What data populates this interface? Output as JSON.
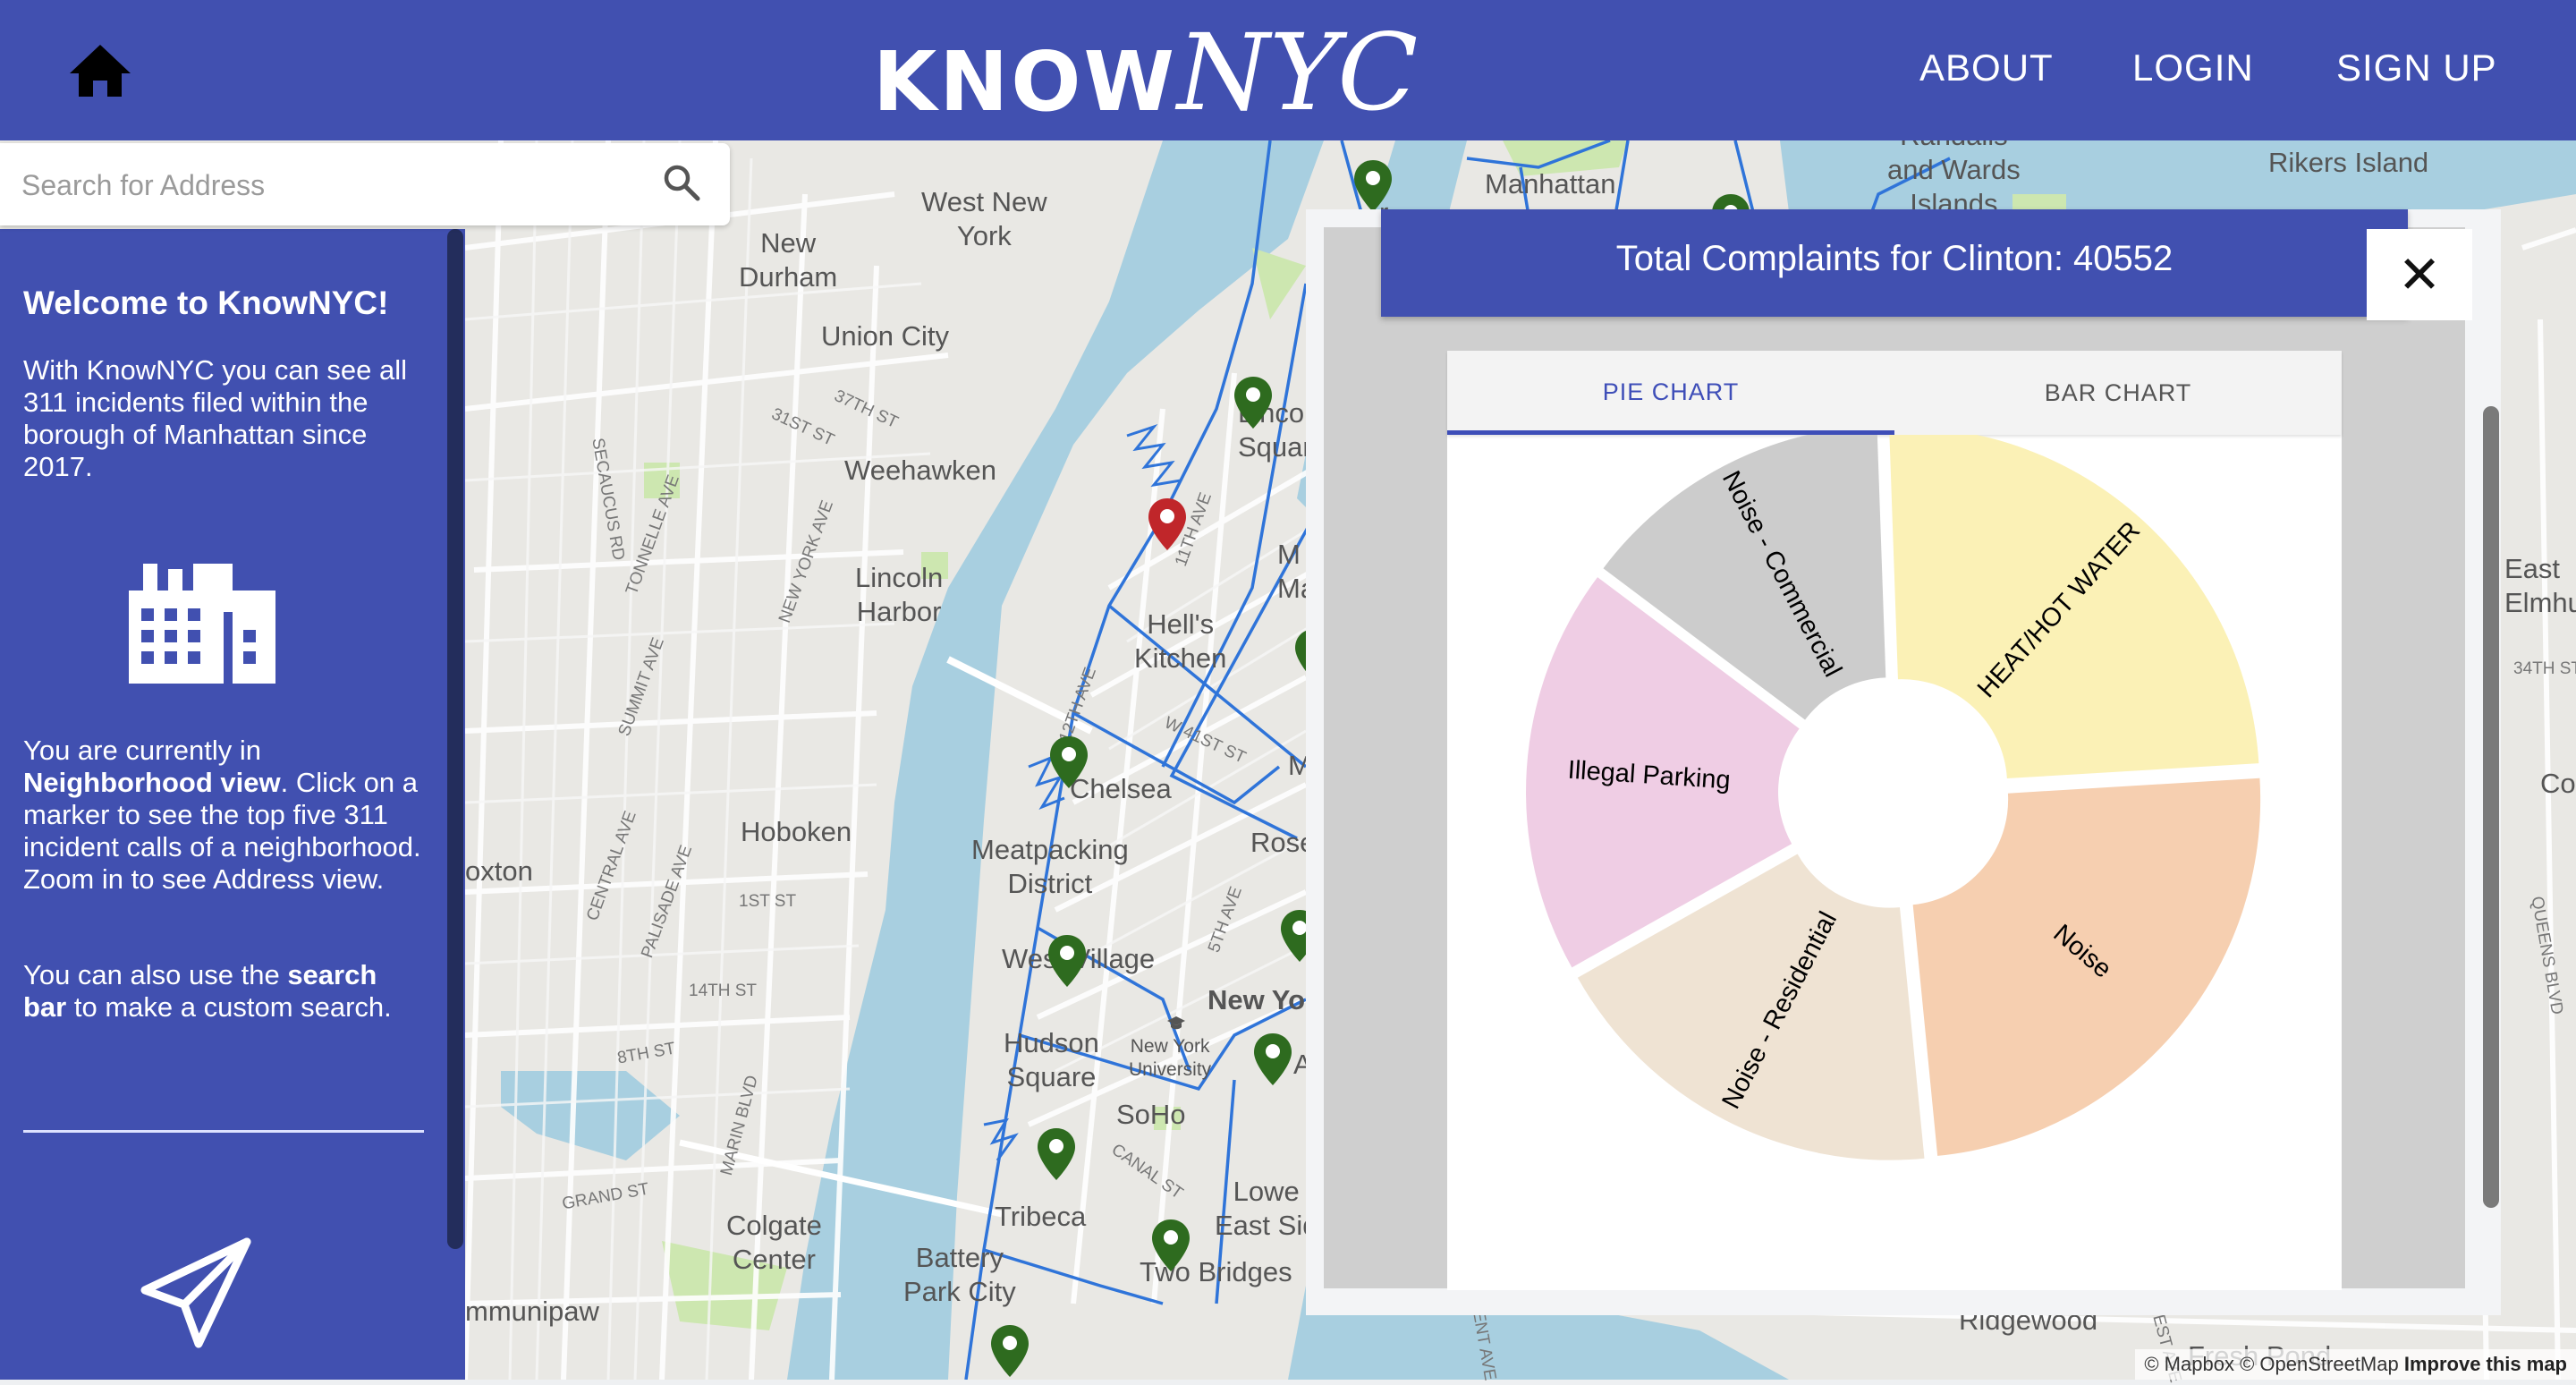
{
  "header": {
    "brand_know": "KNOW",
    "brand_nyc": "NYC",
    "nav": {
      "about": "ABOUT",
      "login": "LOGIN",
      "signup": "SIGN UP"
    }
  },
  "search": {
    "placeholder": "Search for Address"
  },
  "sidebar": {
    "title": "Welcome to KnowNYC!",
    "intro": "With KnowNYC you can see all 311 incidents filed within the borough of Manhattan since 2017.",
    "mode_prefix": "You are currently in ",
    "mode_bold": "Neighborhood view",
    "mode_suffix": ". Click on a marker to see the top five 311 incident calls of a neighborhood. Zoom in to see Address view.",
    "hint_prefix": "You can also use the ",
    "hint_bold": "search bar",
    "hint_suffix": " to make a custom search."
  },
  "map": {
    "labels": {
      "west_new_york": "West New\nYork",
      "new_durham": "New\nDurham",
      "union_city": "Union City",
      "weehawken": "Weehawken",
      "lincoln_harbor": "Lincoln\nHarbor",
      "hoboken": "Hoboken",
      "hells_kitchen": "Hell's\nKitchen",
      "chelsea": "Chelsea",
      "meatpacking": "Meatpacking\nDistrict",
      "west_village": "West Village",
      "new_york": "New Yo",
      "nyu": "New York\nUniversity",
      "hudson_square": "Hudson\nSquare",
      "soho": "SoHo",
      "tribeca": "Tribeca",
      "lower_east_side": "Lowe\nEast Sid",
      "two_bridges": "Two Bridges",
      "battery_park": "Battery\nPark City",
      "colgate_center": "Colgate\nCenter",
      "communipaw": "mmunipaw",
      "oxton": "oxton",
      "manhattan": "Manhattan",
      "randalls": "Randalls\nand Wards\nIslands",
      "rikers": "Rikers Island",
      "east_elmhurst": "East\nElmhur",
      "ridgewood": "Ridgewood",
      "fresh_pond": "Fresh Pond",
      "lincoln_sq": "Linco\nSquar",
      "mid": "M\nMa",
      "mu": "Mu",
      "rose": "Rose",
      "co": "Co",
      "al": "Al",
      "x_r": "r"
    },
    "streets": {
      "s1": "37TH ST",
      "s2": "31ST ST",
      "s3": "SECAUCUS RD",
      "s4": "TONNELLE AVE",
      "s5": "NEW YORK AVE",
      "s6": "SUMMIT AVE",
      "s7": "CENTRAL AVE",
      "s8": "PALISADE AVE",
      "s9": "1ST ST",
      "s10": "14TH ST",
      "s11": "8TH ST",
      "s12": "MARIN BLVD",
      "s13": "GRAND ST",
      "s14": "12TH AVE",
      "s15": "11TH AVE",
      "s16": "W 41ST ST",
      "s17": "5TH AVE",
      "s18": "CANAL ST",
      "s19": "34TH ST",
      "s20": "QUEENS BLVD",
      "s21": "KENT AVE",
      "s22": "FOREST AVE"
    },
    "attribution": {
      "mapbox": "© Mapbox",
      "osm": "© OpenStreetMap",
      "improve": "Improve this map"
    }
  },
  "modal": {
    "title": "Total Complaints for Clinton: 40552",
    "close_glyph": "✕",
    "tabs": {
      "pie": "PIE CHART",
      "bar": "BAR CHART"
    },
    "active_tab": "pie"
  },
  "colors": {
    "brand": "#4150b0",
    "marker_green": "#2e6b1f",
    "marker_red": "#c0262a",
    "slice_heat": "#fbf1b6",
    "slice_noise": "#f6cfb0",
    "slice_residential": "#efe3d3",
    "slice_parking": "#efcde4",
    "slice_commercial": "#cccccc"
  },
  "chart_data": {
    "type": "pie",
    "title": "Total Complaints for Clinton: 40552",
    "donut": true,
    "categories": [
      "HEAT/HOT WATER",
      "Noise",
      "Noise - Residential",
      "Illegal Parking",
      "Noise - Commercial"
    ],
    "values": [
      0.246,
      0.244,
      0.184,
      0.184,
      0.142
    ],
    "colors": [
      "#fbf1b6",
      "#f6cfb0",
      "#efe3d3",
      "#efcde4",
      "#cccccc"
    ]
  }
}
